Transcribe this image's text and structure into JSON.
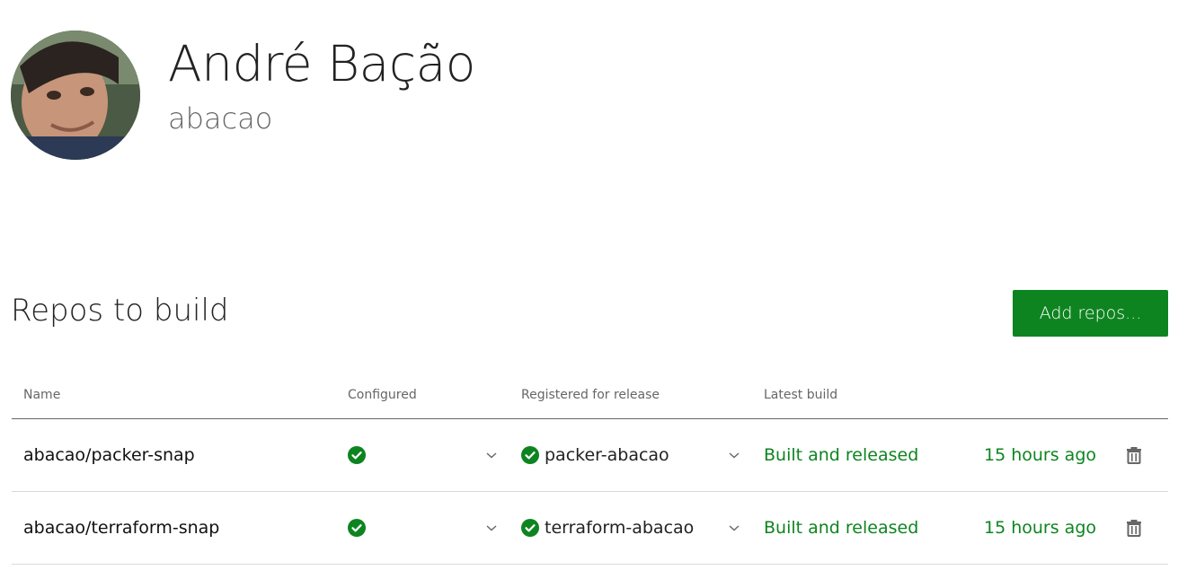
{
  "profile": {
    "display_name": "André Bação",
    "username": "abacao"
  },
  "section": {
    "title": "Repos to build",
    "add_button_label": "Add repos..."
  },
  "table": {
    "headers": {
      "name": "Name",
      "configured": "Configured",
      "registered": "Registered for release",
      "latest_build": "Latest build"
    },
    "rows": [
      {
        "name": "abacao/packer-snap",
        "configured_icon": "check-circle-icon",
        "snap_name": "packer-abacao",
        "build_status": "Built and released",
        "build_time": "15 hours ago"
      },
      {
        "name": "abacao/terraform-snap",
        "configured_icon": "check-circle-icon",
        "snap_name": "terraform-abacao",
        "build_status": "Built and released",
        "build_time": "15 hours ago"
      }
    ]
  },
  "colors": {
    "accent": "#0e8420",
    "text_primary": "#111111",
    "text_secondary": "#666666",
    "divider": "#d9d9d9"
  }
}
